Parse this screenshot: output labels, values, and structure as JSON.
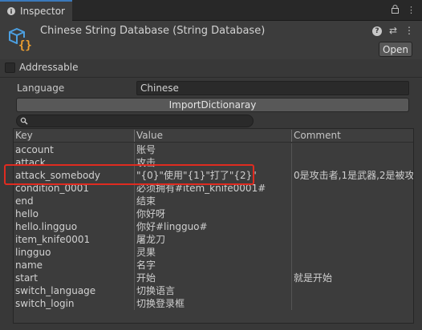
{
  "tab": {
    "label": "Inspector"
  },
  "header": {
    "title": "Chinese String Database (String Database)",
    "open_label": "Open"
  },
  "addressable": {
    "label": "Addressable",
    "checked": false
  },
  "language": {
    "label": "Language",
    "value": "Chinese"
  },
  "import_button": {
    "label": "ImportDictionaray"
  },
  "search": {
    "value": ""
  },
  "table": {
    "headers": {
      "key": "Key",
      "value": "Value",
      "comment": "Comment"
    },
    "rows": [
      {
        "key": "account",
        "value": "账号",
        "comment": ""
      },
      {
        "key": "attack",
        "value": "攻击",
        "comment": ""
      },
      {
        "key": "attack_somebody",
        "value": "\"{0}\"使用\"{1}\"打了\"{2}\"",
        "comment": "0是攻击者,1是武器,2是被攻"
      },
      {
        "key": "condition_0001",
        "value": "必须拥有#item_knife0001#",
        "comment": ""
      },
      {
        "key": "end",
        "value": "结束",
        "comment": ""
      },
      {
        "key": "hello",
        "value": "你好呀",
        "comment": ""
      },
      {
        "key": "hello.lingguo",
        "value": "你好#lingguo#",
        "comment": ""
      },
      {
        "key": "item_knife0001",
        "value": "屠龙刀",
        "comment": ""
      },
      {
        "key": "lingguo",
        "value": "灵果",
        "comment": ""
      },
      {
        "key": "name",
        "value": "名字",
        "comment": ""
      },
      {
        "key": "start",
        "value": "开始",
        "comment": "就是开始"
      },
      {
        "key": "switch_language",
        "value": "切换语言",
        "comment": ""
      },
      {
        "key": "switch_login",
        "value": "切换登录框",
        "comment": ""
      }
    ]
  },
  "colors": {
    "accent": "#3a79bb",
    "highlight": "#e02b20",
    "asset_icon": "#4c9fe0",
    "asset_braces": "#f0a030"
  }
}
